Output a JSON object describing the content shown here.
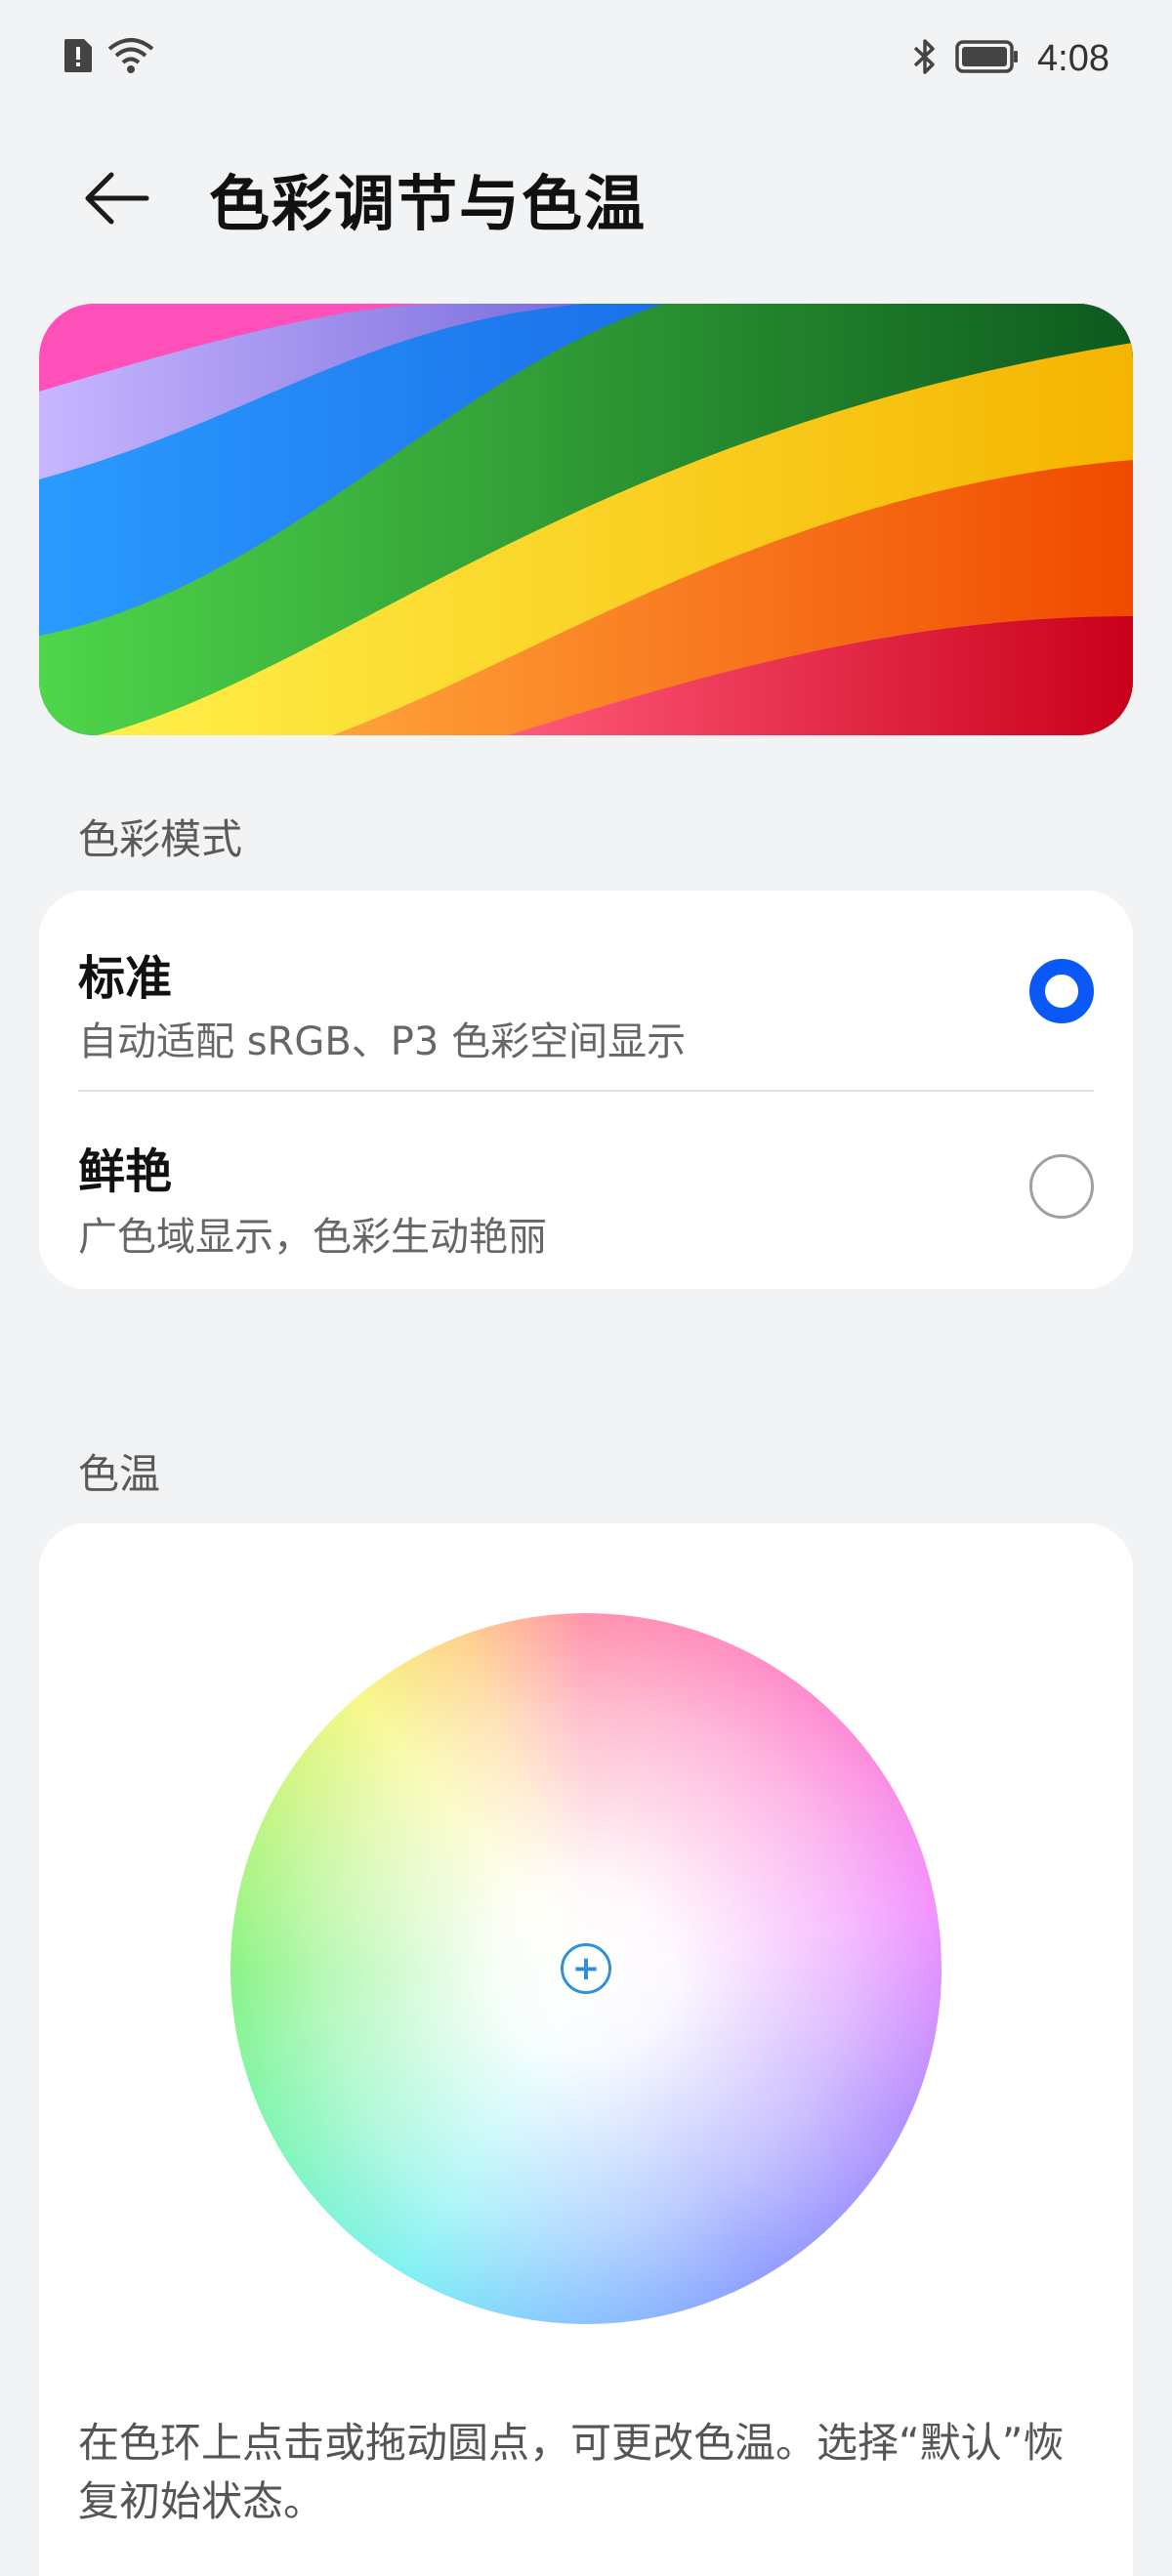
{
  "status_bar": {
    "left_icons": [
      "sim-alert-icon",
      "wifi-icon"
    ],
    "right_icons": [
      "bluetooth-icon",
      "battery-icon"
    ],
    "time": "4:08"
  },
  "header": {
    "title": "色彩调节与色温",
    "back_icon": "arrow-left-icon"
  },
  "color_mode": {
    "section_label": "色彩模式",
    "options": [
      {
        "title": "标准",
        "subtitle": "自动适配 sRGB、P3 色彩空间显示",
        "selected": true
      },
      {
        "title": "鲜艳",
        "subtitle": "广色域显示，色彩生动艳丽",
        "selected": false
      }
    ],
    "accent_color": "#0a59f7"
  },
  "color_temp": {
    "section_label": "色温",
    "hint": "在色环上点击或拖动圆点，可更改色温。选择“默认”恢复初始状态。",
    "handle_icon": "plus-icon"
  }
}
